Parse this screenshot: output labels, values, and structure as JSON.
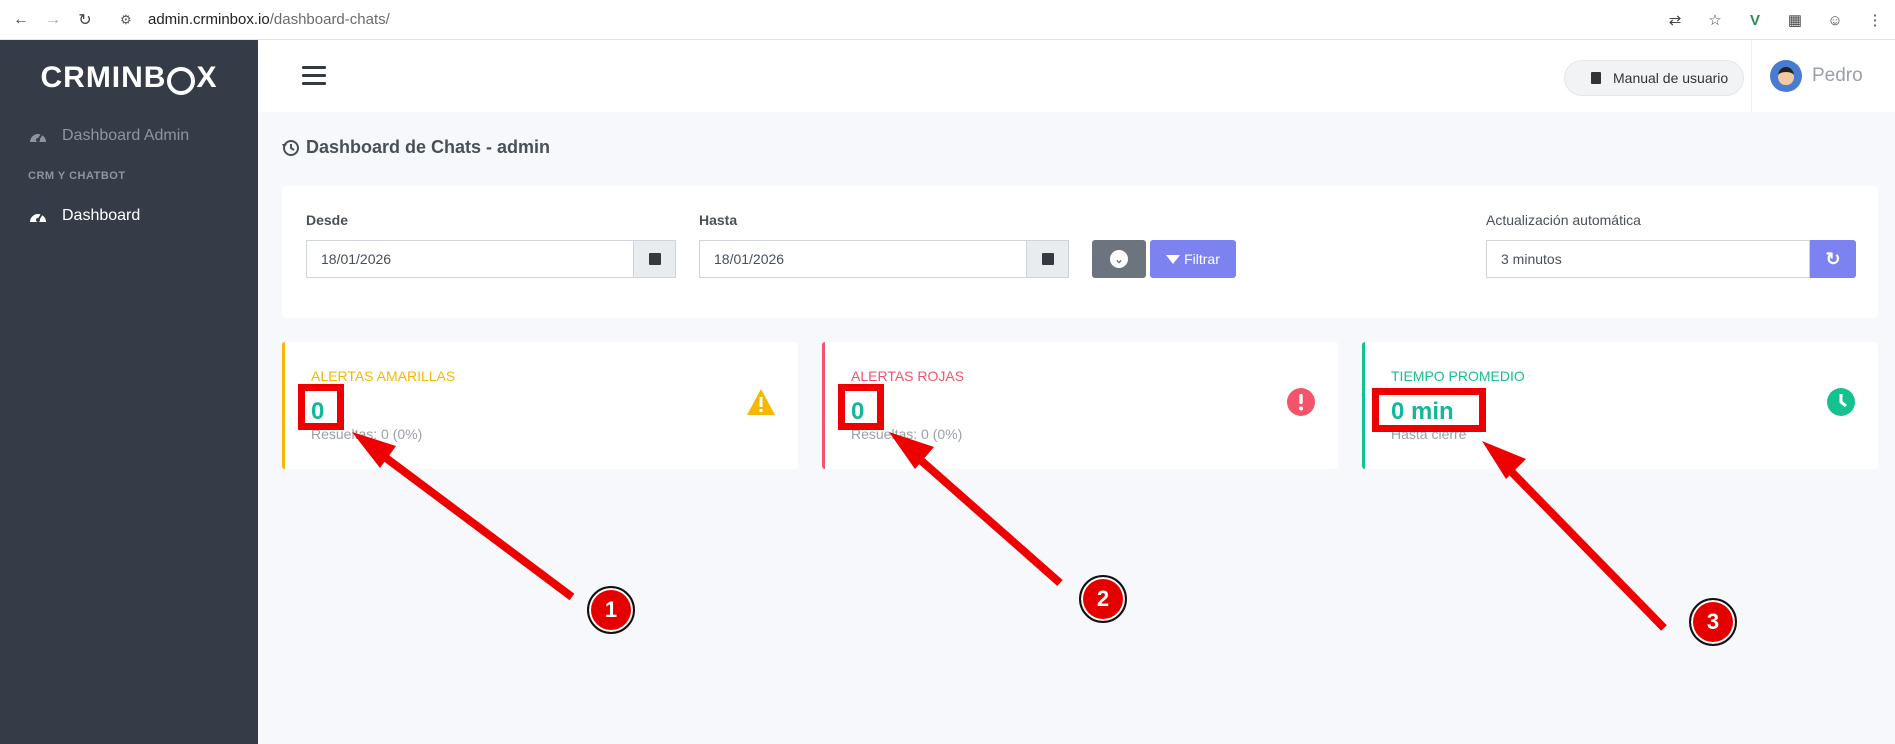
{
  "browser": {
    "url_host": "admin.crminbox.io",
    "url_path": "/dashboard-chats/"
  },
  "sidebar": {
    "brand_left": "CRMINB",
    "brand_right": "X",
    "items": [
      {
        "label": "Dashboard Admin"
      },
      {
        "label": "Dashboard"
      }
    ],
    "section_header": "CRM Y CHATBOT"
  },
  "header": {
    "manual_label": "Manual de usuario",
    "user_name": "Pedro"
  },
  "page": {
    "title": "Dashboard de Chats - admin"
  },
  "filters": {
    "desde_label": "Desde",
    "desde_value": "18/01/2026",
    "hasta_label": "Hasta",
    "hasta_value": "18/01/2026",
    "filter_button": "Filtrar",
    "auto_label": "Actualización automática",
    "auto_value": "3 minutos"
  },
  "cards": [
    {
      "title": "ALERTAS AMARILLAS",
      "value": "0",
      "sub": "Resueltas: 0 (0%)",
      "color": "#f5b800",
      "icon": "warning-icon"
    },
    {
      "title": "ALERTAS ROJAS",
      "value": "0",
      "sub": "Resueltas: 0 (0%)",
      "color": "#f3546c",
      "icon": "exclamation-icon"
    },
    {
      "title": "TIEMPO PROMEDIO",
      "value": "0 min",
      "sub": "Hasta cierre",
      "color": "#13c28e",
      "icon": "clock-icon"
    }
  ],
  "annotations": [
    {
      "number": "1"
    },
    {
      "number": "2"
    },
    {
      "number": "3"
    }
  ]
}
